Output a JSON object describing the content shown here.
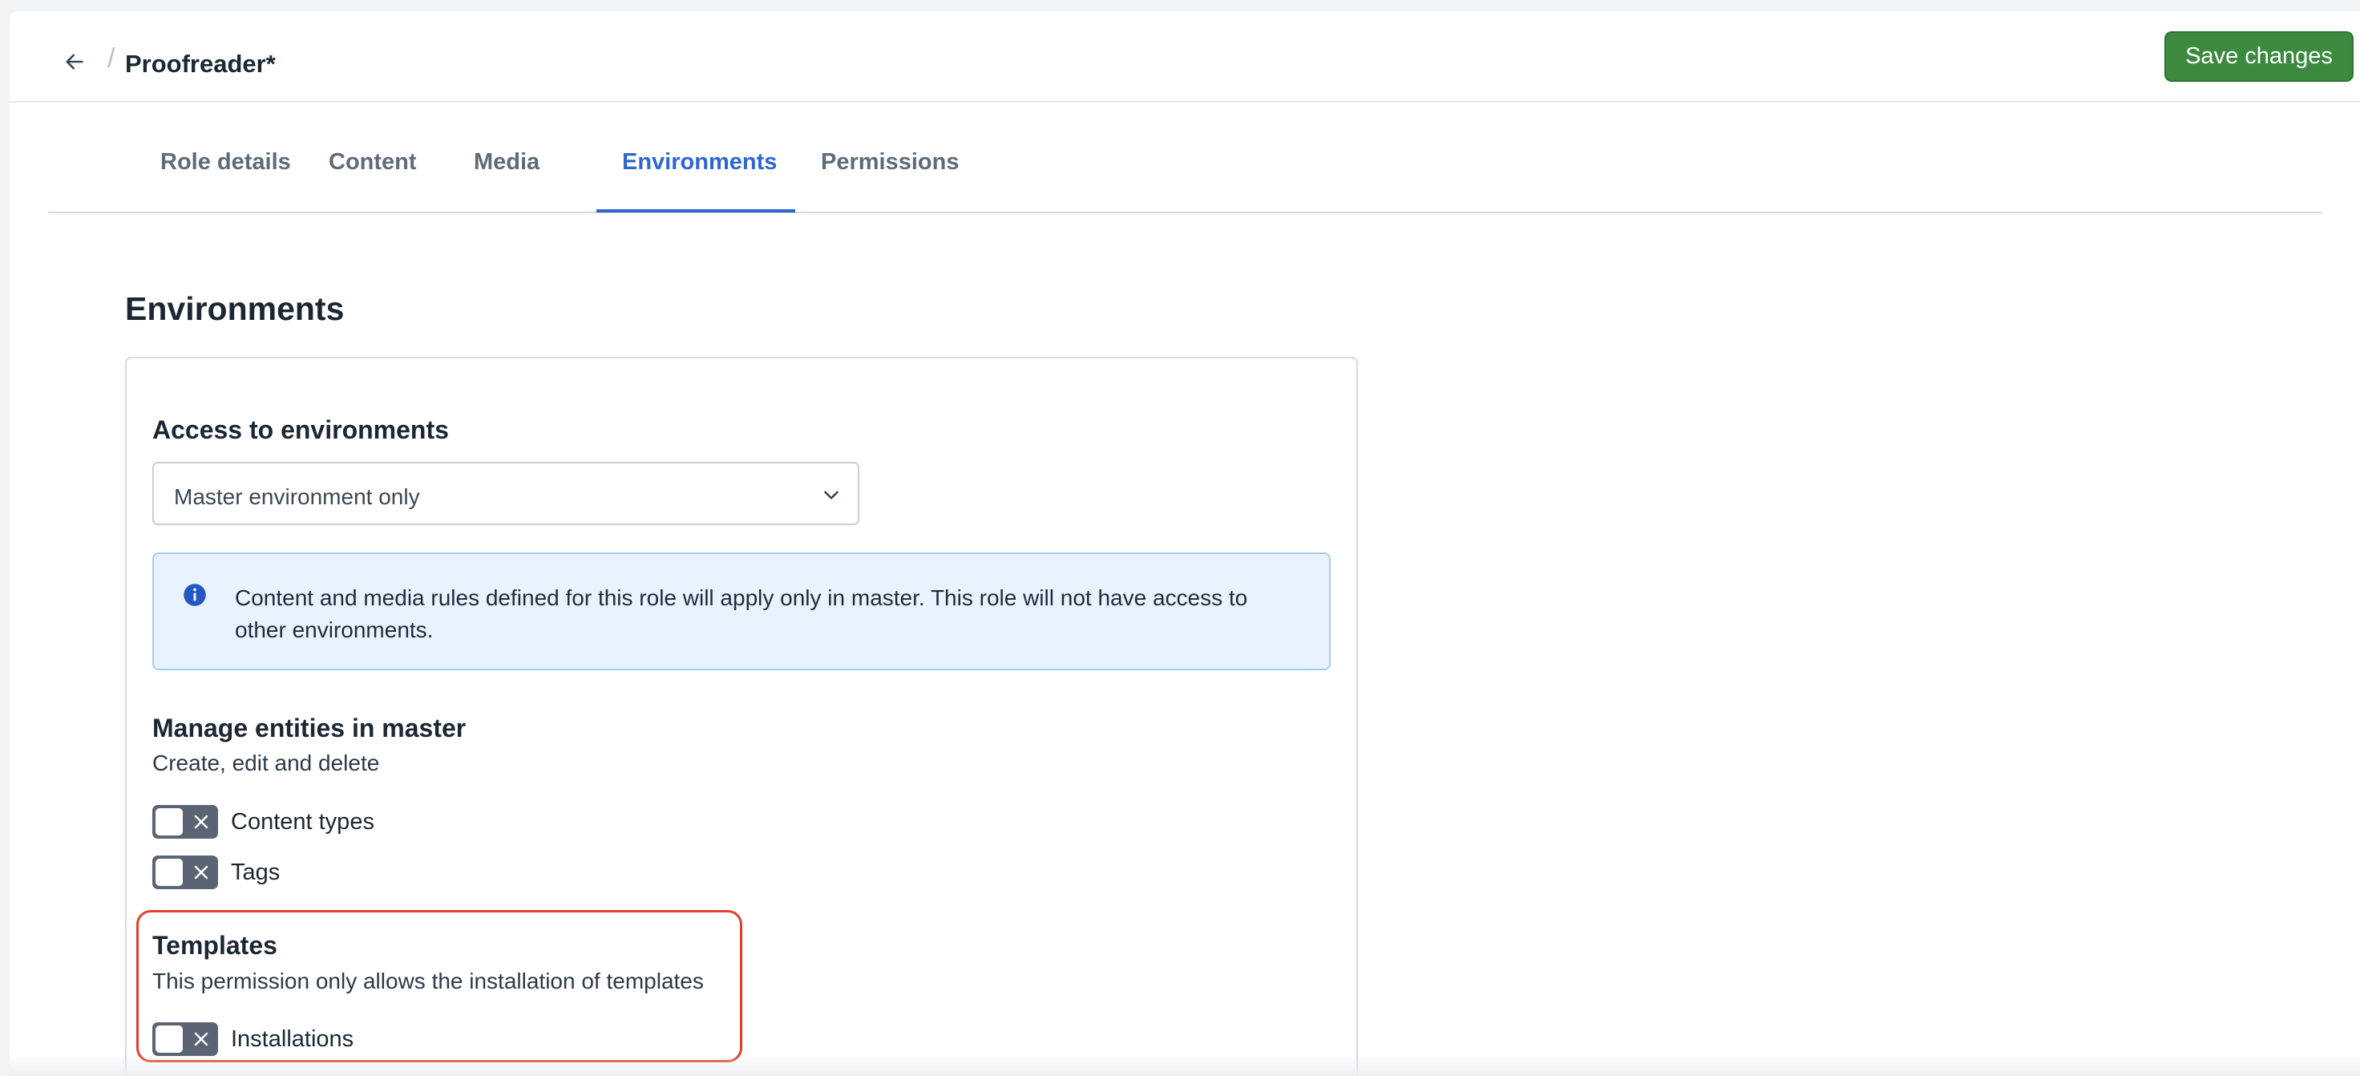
{
  "header": {
    "breadcrumb_sep": "/",
    "title": "Proofreader*",
    "save_label": "Save changes"
  },
  "tabs": [
    {
      "label": "Role details",
      "active": false
    },
    {
      "label": "Content",
      "active": false
    },
    {
      "label": "Media",
      "active": false
    },
    {
      "label": "Environments",
      "active": true
    },
    {
      "label": "Permissions",
      "active": false
    }
  ],
  "section": {
    "title": "Environments"
  },
  "access": {
    "title": "Access to environments",
    "select_value": "Master environment only",
    "info_text": "Content and media rules defined for this role will apply only in master. This role will not have access to other environments."
  },
  "manage": {
    "title": "Manage entities in master",
    "subtitle": "Create, edit and delete",
    "toggles": [
      {
        "label": "Content types",
        "on": false
      },
      {
        "label": "Tags",
        "on": false
      }
    ]
  },
  "templates": {
    "title": "Templates",
    "subtitle": "This permission only allows the installation of templates",
    "toggles": [
      {
        "label": "Installations",
        "on": false
      }
    ]
  },
  "colors": {
    "accent": "#2e67d1",
    "save": "#3b8a3e",
    "highlight": "#e04030",
    "info_bg": "#e8f3fd"
  },
  "icons": {
    "back": "arrow-left-icon",
    "chevron": "chevron-down-icon",
    "info": "info-icon",
    "toggle_off": "close-icon"
  }
}
